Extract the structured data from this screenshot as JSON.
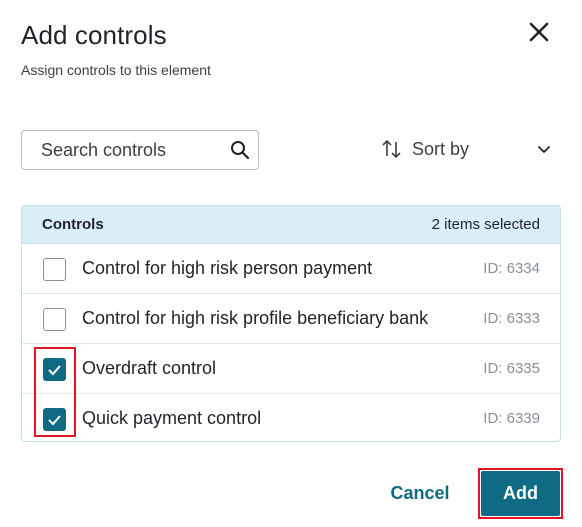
{
  "dialog": {
    "title": "Add controls",
    "subtitle": "Assign controls to this element"
  },
  "search": {
    "placeholder": "Search controls",
    "value": ""
  },
  "sort": {
    "label": "Sort by"
  },
  "table": {
    "header_label": "Controls",
    "selected_count": "2 items selected",
    "rows": [
      {
        "label": "Control for high risk person payment",
        "id": "ID: 6334",
        "checked": false
      },
      {
        "label": "Control for high risk profile beneficiary bank",
        "id": "ID: 6333",
        "checked": false
      },
      {
        "label": "Overdraft control",
        "id": "ID: 6335",
        "checked": true
      },
      {
        "label": "Quick payment control",
        "id": "ID: 6339",
        "checked": true
      }
    ]
  },
  "footer": {
    "cancel_label": "Cancel",
    "add_label": "Add"
  },
  "colors": {
    "accent": "#0e6b83",
    "header_bg": "#d9eef6",
    "highlight": "#e3141f"
  },
  "icons": [
    "close-icon",
    "search-icon",
    "sort-icon",
    "chevron-down-icon",
    "checkmark-icon"
  ]
}
